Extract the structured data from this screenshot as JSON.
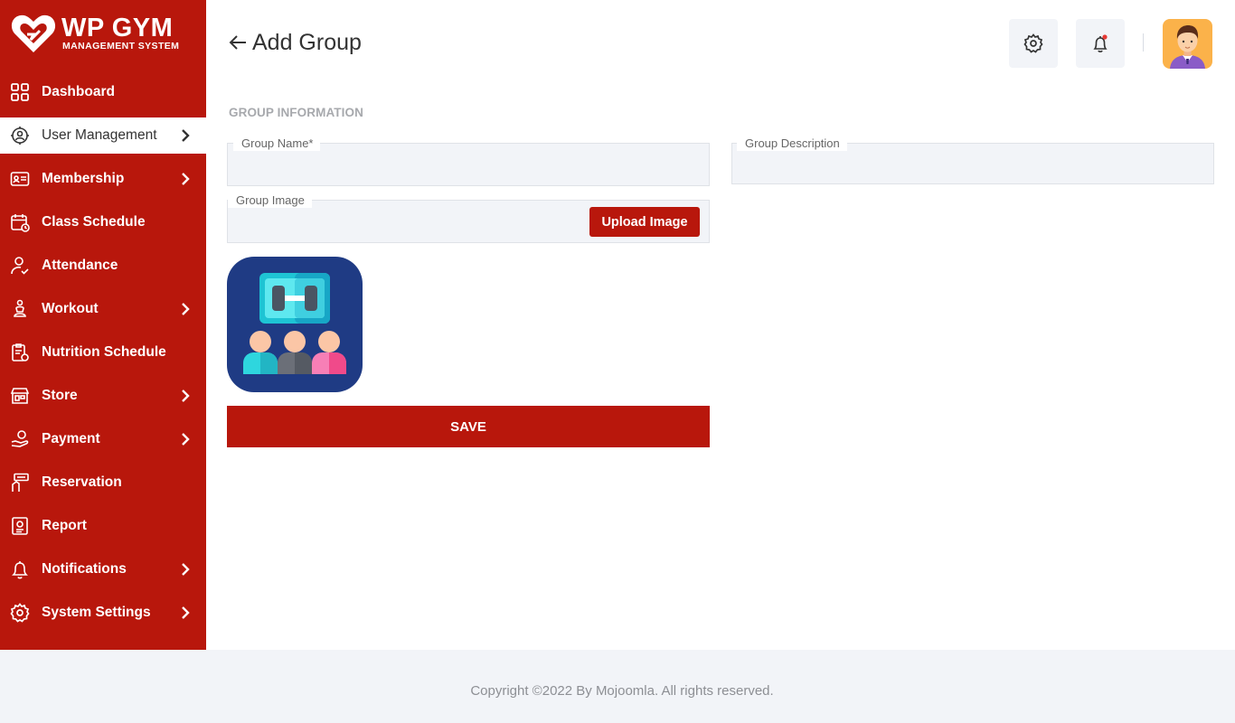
{
  "brand": {
    "name": "WP GYM",
    "subtitle": "MANAGEMENT SYSTEM",
    "logo_icon": "heart-logo-icon"
  },
  "colors": {
    "primary": "#b8170c",
    "background": "#ffffff",
    "surface": "#f2f4f8",
    "muted_text": "#a7a9ad"
  },
  "sidebar": {
    "items": [
      {
        "label": "Dashboard",
        "icon": "dashboard-grid-icon",
        "has_submenu": false,
        "active": false
      },
      {
        "label": "User Management",
        "icon": "users-gear-icon",
        "has_submenu": true,
        "active": true
      },
      {
        "label": "Membership",
        "icon": "membership-card-icon",
        "has_submenu": true,
        "active": false
      },
      {
        "label": "Class Schedule",
        "icon": "calendar-icon",
        "has_submenu": false,
        "active": false
      },
      {
        "label": "Attendance",
        "icon": "user-check-icon",
        "has_submenu": false,
        "active": false
      },
      {
        "label": "Workout",
        "icon": "workout-icon",
        "has_submenu": true,
        "active": false
      },
      {
        "label": "Nutrition Schedule",
        "icon": "clipboard-apple-icon",
        "has_submenu": false,
        "active": false
      },
      {
        "label": "Store",
        "icon": "store-icon",
        "has_submenu": true,
        "active": false
      },
      {
        "label": "Payment",
        "icon": "payment-hand-icon",
        "has_submenu": true,
        "active": false
      },
      {
        "label": "Reservation",
        "icon": "reservation-icon",
        "has_submenu": false,
        "active": false
      },
      {
        "label": "Report",
        "icon": "report-icon",
        "has_submenu": false,
        "active": false
      },
      {
        "label": "Notifications",
        "icon": "bell-icon",
        "has_submenu": true,
        "active": false
      },
      {
        "label": "System Settings",
        "icon": "gear-icon",
        "has_submenu": true,
        "active": false
      }
    ]
  },
  "header": {
    "title": "Add Group",
    "back_icon": "arrow-left-icon",
    "settings_icon": "gear-icon",
    "notification_icon": "bell-icon",
    "avatar_icon": "user-avatar-icon"
  },
  "form": {
    "section_title": "GROUP INFORMATION",
    "group_name": {
      "label": "Group Name*",
      "value": ""
    },
    "group_description": {
      "label": "Group Description",
      "value": ""
    },
    "group_image": {
      "label": "Group Image",
      "value": "",
      "upload_label": "Upload Image"
    },
    "preview_icon": "group-workout-icon",
    "save_label": "SAVE"
  },
  "footer": {
    "copyright": "Copyright ©2022 By Mojoomla. All rights reserved."
  }
}
